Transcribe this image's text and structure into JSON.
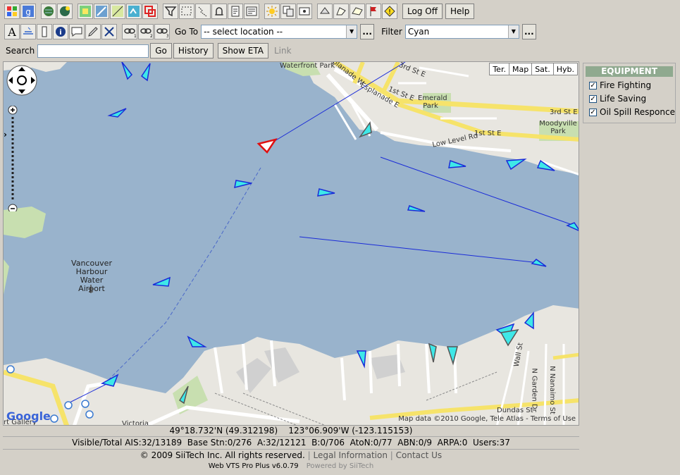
{
  "toolbar1": {
    "icons": [
      "windows-icon",
      "google-icon",
      "globe1-icon",
      "globe2-icon",
      "layer-color-icon",
      "zoom-area-icon",
      "map-draw-icon",
      "map-tools-icon",
      "layers-icon",
      "filter-icon",
      "select-rect-icon",
      "track-icon",
      "alarm-icon",
      "report-icon",
      "screen-icon",
      "sun-icon",
      "copy-icon",
      "display-icon",
      "tools-a-icon",
      "tools-b-icon",
      "tools-c-icon",
      "flag-icon",
      "warning-icon"
    ],
    "logoff": "Log Off",
    "help": "Help"
  },
  "toolbar2": {
    "goto_label": "Go To",
    "goto_value": "-- select location --",
    "filter_label": "Filter",
    "filter_value": "Cyan",
    "dots": "..."
  },
  "search": {
    "label": "Search",
    "value": "",
    "go": "Go",
    "history": "History",
    "show_eta": "Show ETA",
    "link": "Link"
  },
  "map": {
    "types": [
      "Ter.",
      "Map",
      "Sat.",
      "Hyb."
    ],
    "labels": {
      "waterfront": "Waterfront Park",
      "esplanade_w": "Esplanade W",
      "esplanade_e": "Esplanade E",
      "st3": "3rd St E",
      "st3b": "3rd St E",
      "st1": "1st St E",
      "st1b": "1st St E",
      "emerald": "Emerald Park",
      "moodyville": "Moodyville Park",
      "lowlevel": "Low Level Rd",
      "airport": "Vancouver Harbour Water Airport",
      "wall": "Wall St",
      "garden": "N Garden Dr",
      "nanaimo": "N Nanaimo St",
      "dundas": "Dundas St",
      "victoria": "Victoria",
      "artgallery": "rt Gallery"
    },
    "attribution": "Map data ©2010 Google, Tele Atlas - Terms of Use",
    "google": "Google"
  },
  "equipment": {
    "title": "EQUIPMENT",
    "items": [
      {
        "label": "Fire Fighting",
        "checked": true
      },
      {
        "label": "Life Saving",
        "checked": true
      },
      {
        "label": "Oil Spill Responce",
        "checked": true
      }
    ]
  },
  "status": {
    "coords": "49°18.732'N (49.312198)    123°06.909'W (-123.115153)",
    "counts": "Visible/Total AIS:32/13189  Base Stn:0/276  A:32/12121  B:0/706  AtoN:0/77  ABN:0/9  ARPA:0  Users:37"
  },
  "footer": {
    "copyright": "© 2009 SiiTech Inc. All rights reserved.",
    "legal": "Legal Information",
    "contact": "Contact Us",
    "version": "Web VTS Pro Plus v6.0.79",
    "powered": "Powered by SiiTech"
  },
  "colors": {
    "water": "#99b3cc",
    "land": "#e8e6e0",
    "road": "#f6e36a",
    "park": "#c8dfb0",
    "vessel_blue": "#1a2bd8",
    "vessel_cyan": "#3ee8e8",
    "selected": "#e01010"
  }
}
